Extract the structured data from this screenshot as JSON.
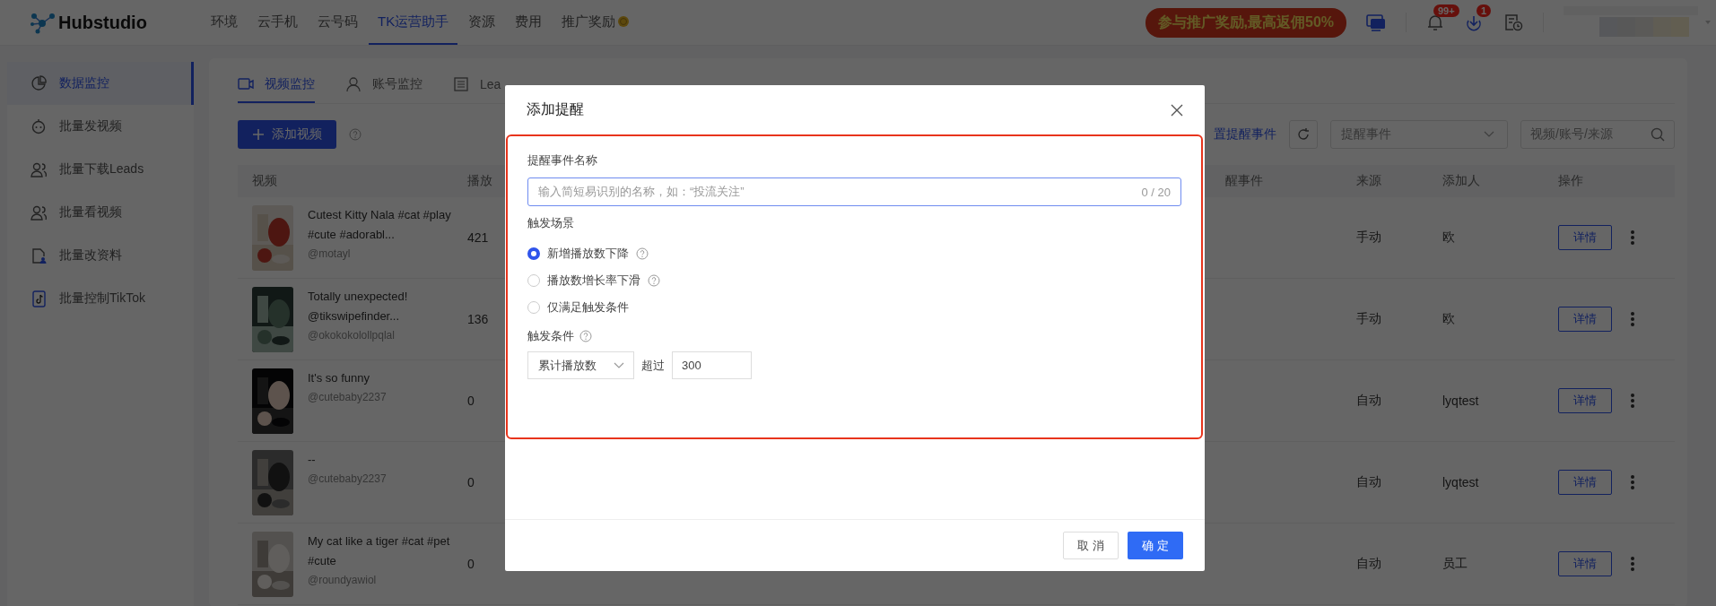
{
  "app": {
    "logo": "Hubstudio",
    "promo_banner": "参与推广奖励,最高返佣50%",
    "notifications_badge": "99+",
    "downloads_badge": "1"
  },
  "nav": [
    {
      "label": "环境",
      "selected": false,
      "coin": false
    },
    {
      "label": "云手机",
      "selected": false,
      "coin": false
    },
    {
      "label": "云号码",
      "selected": false,
      "coin": false
    },
    {
      "label": "TK运营助手",
      "selected": true,
      "coin": false
    },
    {
      "label": "资源",
      "selected": false,
      "coin": false
    },
    {
      "label": "费用",
      "selected": false,
      "coin": false
    },
    {
      "label": "推广奖励",
      "selected": false,
      "coin": true
    }
  ],
  "sidebar": {
    "items": [
      {
        "label": "数据监控",
        "selected": true
      },
      {
        "label": "批量发视频",
        "selected": false
      },
      {
        "label": "批量下载Leads",
        "selected": false
      },
      {
        "label": "批量看视频",
        "selected": false
      },
      {
        "label": "批量改资料",
        "selected": false
      },
      {
        "label": "批量控制TikTok",
        "selected": false
      }
    ]
  },
  "tabs": [
    {
      "label": "视频监控",
      "selected": true
    },
    {
      "label": "账号监控",
      "selected": false
    },
    {
      "label": "Lea",
      "selected": false
    }
  ],
  "toolbar": {
    "add_button": "添加视频",
    "settings_link": "置提醒事件",
    "event_filter": {
      "placeholder": "提醒事件"
    },
    "search": {
      "placeholder": "视频/账号/来源"
    }
  },
  "table": {
    "columns": [
      "视频",
      "播放",
      "醒事件",
      "来源",
      "添加人",
      "操作"
    ],
    "rows": [
      {
        "title": "Cutest Kitty Nala #cat #play #cute #adorabl...",
        "author": "@motayl",
        "plays": "421",
        "source": "手动",
        "added_by": "欧",
        "action": "详情"
      },
      {
        "title": "Totally unexpected! @tikswipefinder...",
        "author": "@okokokolollpqlal",
        "plays": "136",
        "source": "手动",
        "added_by": "欧",
        "action": "详情"
      },
      {
        "title": "It's so funny",
        "author": "@cutebaby2237",
        "plays": "0",
        "source": "自动",
        "added_by": "lyqtest",
        "action": "详情"
      },
      {
        "title": "--",
        "author": "@cutebaby2237",
        "plays": "0",
        "source": "自动",
        "added_by": "lyqtest",
        "action": "详情"
      },
      {
        "title": "My cat like a tiger #cat #pet #cute",
        "author": "@roundyawiol",
        "plays": "0",
        "source": "自动",
        "added_by": "员工",
        "action": "详情"
      }
    ]
  },
  "dialog": {
    "title": "添加提醒",
    "name_label": "提醒事件名称",
    "name_input": {
      "placeholder": "输入简短易识别的名称，如：“投流关注”"
    },
    "counter": "0 / 20",
    "scene_label": "触发场景",
    "options": [
      {
        "label": "新增播放数下降",
        "selected": true,
        "help": true
      },
      {
        "label": "播放数增长率下滑",
        "selected": false,
        "help": true
      },
      {
        "label": "仅满足触发条件",
        "selected": false,
        "help": false
      }
    ],
    "condition_label": "触发条件",
    "metric_select": "累计播放数",
    "exceed_label": "超过",
    "threshold": "300",
    "cancel_button": "取 消",
    "ok_button": "确 定"
  }
}
